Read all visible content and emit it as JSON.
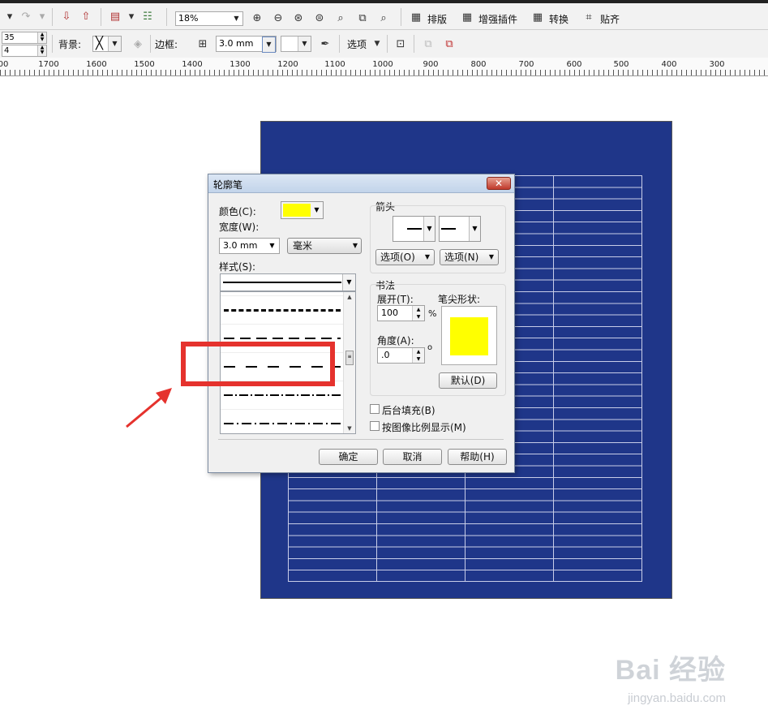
{
  "toolbar": {
    "zoom": "18%",
    "menus": [
      "排版",
      "增强插件",
      "转换",
      "贴齐"
    ]
  },
  "propbar": {
    "spin1": "35",
    "spin2": "4",
    "bg_label": "背景:",
    "border_label": "边框:",
    "width_value": "3.0 mm",
    "options_label": "选项"
  },
  "ruler": {
    "labels": [
      "00",
      "1700",
      "1600",
      "1500",
      "1400",
      "1300",
      "1200",
      "1100",
      "1000",
      "900",
      "800",
      "700",
      "600",
      "500",
      "400",
      "300"
    ]
  },
  "dialog": {
    "title": "轮廓笔",
    "color_label": "颜色(C):",
    "color_value": "#ffff00",
    "width_label": "宽度(W):",
    "width_value": "3.0 mm",
    "unit_value": "毫米",
    "style_label": "样式(S):",
    "arrow_group": "箭头",
    "arrow_opt_left": "选项(O)",
    "arrow_opt_right": "选项(N)",
    "calligraphy_group": "书法",
    "stretch_label": "展开(T):",
    "stretch_value": "100",
    "stretch_unit": "%",
    "nib_label": "笔尖形状:",
    "angle_label": "角度(A):",
    "angle_value": ".0",
    "angle_unit": "o",
    "default_button": "默认(D)",
    "behind_fill": "后台填充(B)",
    "scale_with_image": "按图像比例显示(M)",
    "ok": "确定",
    "cancel": "取消",
    "help": "帮助(H)"
  },
  "watermark": {
    "logo": "Bai 经验",
    "url": "jingyan.baidu.com"
  },
  "colors": {
    "page": "#1f3689",
    "highlight": "#e5322d",
    "nib": "#ffff00"
  }
}
